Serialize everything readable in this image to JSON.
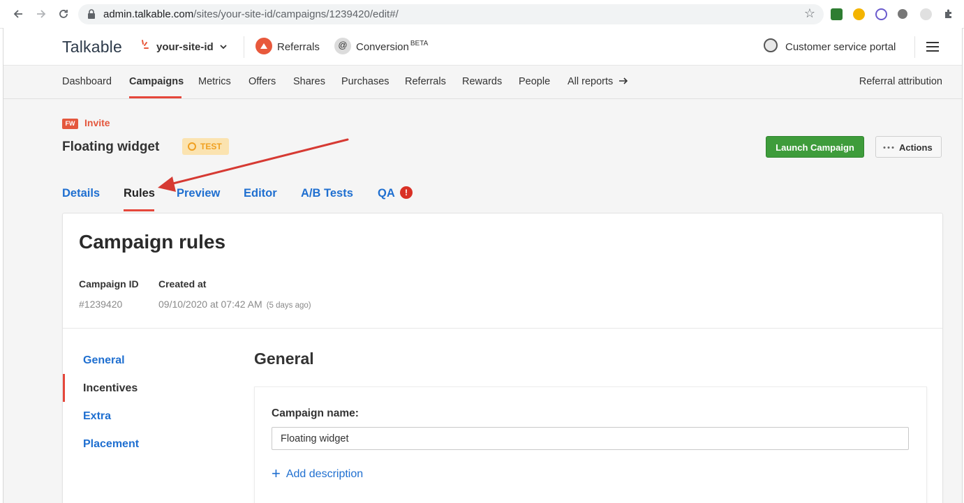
{
  "browser": {
    "url_host": "admin.talkable.com",
    "url_path": "/sites/your-site-id/campaigns/1239420/edit#/",
    "icons": [
      "back-arrow-icon",
      "forward-arrow-icon",
      "reload-icon",
      "lock-icon",
      "star-icon",
      "extensions-icon"
    ]
  },
  "topnav": {
    "logo": "Talkable",
    "site": "your-site-id",
    "products": [
      {
        "label": "Referrals",
        "color": "#e8593c"
      },
      {
        "label": "Conversion",
        "beta": "BETA",
        "color": "#dcdcdc"
      }
    ],
    "portal": "Customer service portal"
  },
  "subnav": {
    "items": [
      "Dashboard",
      "Campaigns",
      "Metrics",
      "Offers",
      "Shares",
      "Purchases",
      "Referrals",
      "Rewards",
      "People",
      "All reports"
    ],
    "active": "Campaigns",
    "right": "Referral attribution"
  },
  "campaign": {
    "badge": "FW",
    "type": "Invite",
    "name": "Floating widget",
    "status": "TEST",
    "launch_label": "Launch Campaign",
    "actions_label": "Actions"
  },
  "tabs": {
    "items": [
      "Details",
      "Rules",
      "Preview",
      "Editor",
      "A/B Tests",
      "QA"
    ],
    "active": "Rules",
    "qa_alert": "!"
  },
  "rules": {
    "title": "Campaign rules",
    "id_label": "Campaign ID",
    "id_value": "#1239420",
    "created_label": "Created at",
    "created_value": "09/10/2020 at 07:42 AM",
    "created_ago": "(5 days ago)",
    "sidebar": [
      "General",
      "Incentives",
      "Extra",
      "Placement"
    ],
    "sidebar_active": "Incentives",
    "section_title": "General",
    "name_label": "Campaign name:",
    "name_value": "Floating widget",
    "add_description": "Add description"
  },
  "colors": {
    "accent": "#e5473b",
    "link": "#1f6fd0",
    "launch": "#3e9c3b",
    "test_badge": "#fbe3b0",
    "annotation_arrow": "#d63a33"
  }
}
